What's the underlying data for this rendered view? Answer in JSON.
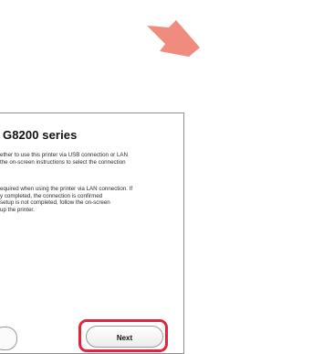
{
  "pointer": {
    "icon": "pointer-arrow-icon",
    "color": "#f08c7e"
  },
  "dialog": {
    "title": "G8200 series",
    "paragraph1": [
      "ether to use this printer via USB connection or LAN",
      "the on-screen instructions to select the connection"
    ],
    "paragraph2": [
      "equired when using the printer via LAN connection. If",
      "y completed, the connection is confirmed",
      " setup is not completed, follow the on-screen",
      "up the printer."
    ]
  },
  "buttons": {
    "next_label": "Next",
    "highlight_color": "#e0263c"
  }
}
